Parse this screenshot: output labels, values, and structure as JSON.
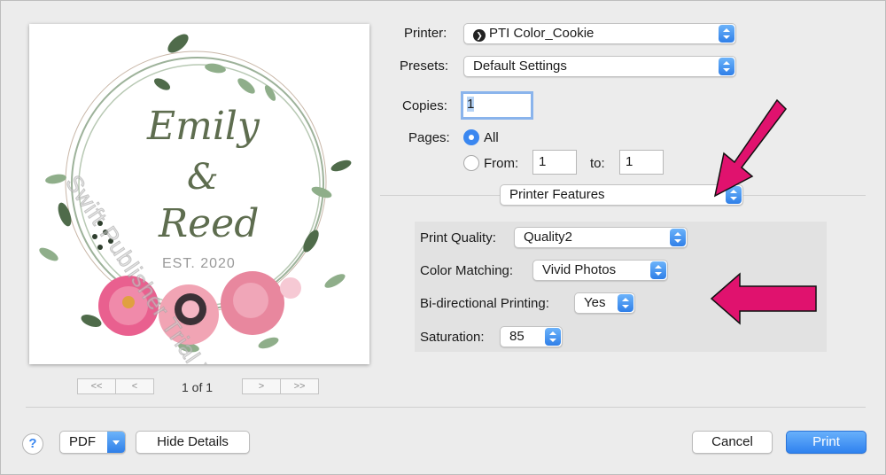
{
  "preview": {
    "card_lines": [
      "Emily",
      "&",
      "Reed",
      "EST. 2020"
    ],
    "watermark": "Swift Publisher Trial Version",
    "page_count": "1 of 1",
    "nav": {
      "first": "<<",
      "prev": "<",
      "next": ">",
      "last": ">>"
    }
  },
  "printer": {
    "label": "Printer:",
    "value": "PTI Color_Cookie"
  },
  "presets": {
    "label": "Presets:",
    "value": "Default Settings"
  },
  "copies": {
    "label": "Copies:",
    "value": "1"
  },
  "pages": {
    "label": "Pages:",
    "all_label": "All",
    "from_label": "From:",
    "from_value": "1",
    "to_label": "to:",
    "to_value": "1",
    "selected": "All"
  },
  "section_menu": {
    "value": "Printer Features"
  },
  "features": {
    "print_quality": {
      "label": "Print Quality:",
      "value": "Quality2"
    },
    "color_matching": {
      "label": "Color Matching:",
      "value": "Vivid Photos"
    },
    "bidirectional": {
      "label": "Bi-directional Printing:",
      "value": "Yes"
    },
    "saturation": {
      "label": "Saturation:",
      "value": "85"
    }
  },
  "footer": {
    "help": "?",
    "pdf": "PDF",
    "hide_details": "Hide Details",
    "cancel": "Cancel",
    "print": "Print"
  },
  "colors": {
    "accent": "#3a87f0",
    "annotation_arrow": "#e0126e",
    "dialog_bg": "#ececec"
  }
}
